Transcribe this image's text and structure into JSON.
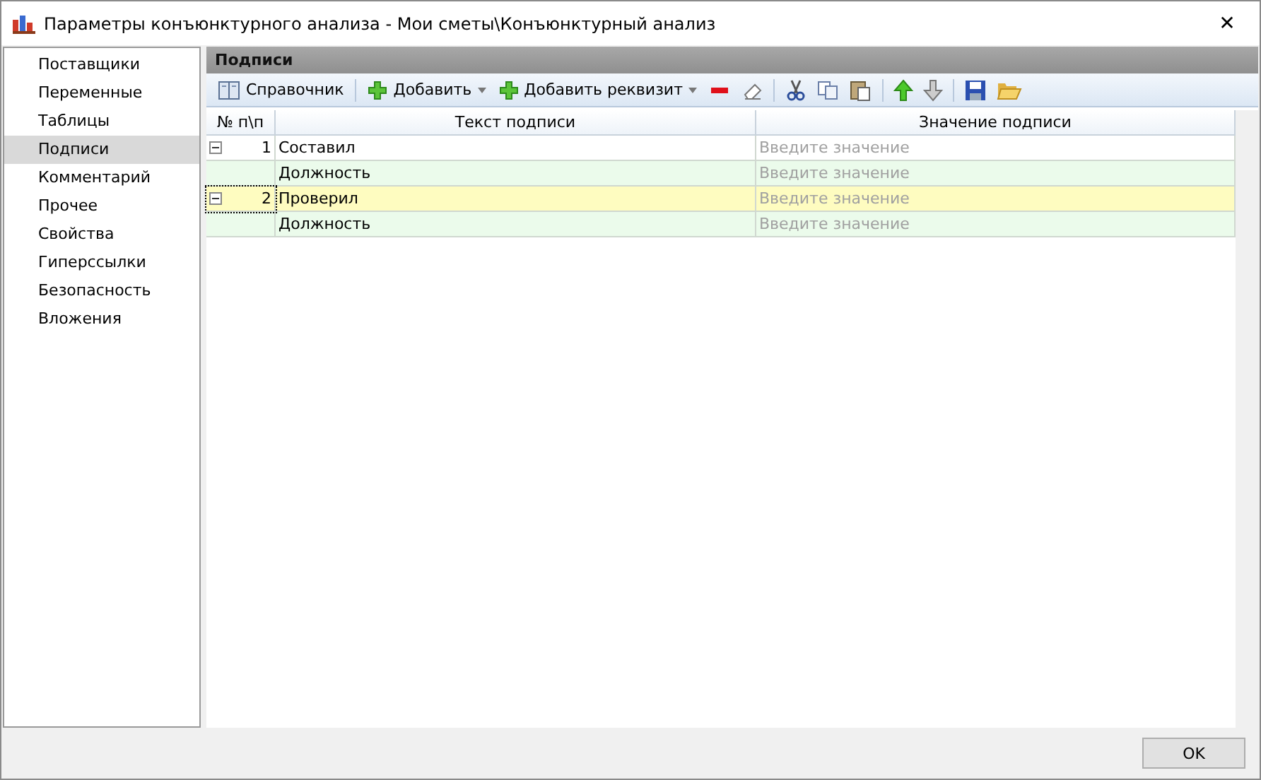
{
  "window": {
    "title": "Параметры конъюнктурного анализа - Мои сметы\\Конъюнктурный анализ",
    "close": "✕"
  },
  "sidebar": {
    "items": [
      {
        "label": "Поставщики",
        "selected": false
      },
      {
        "label": "Переменные",
        "selected": false
      },
      {
        "label": "Таблицы",
        "selected": false
      },
      {
        "label": "Подписи",
        "selected": true
      },
      {
        "label": "Комментарий",
        "selected": false
      },
      {
        "label": "Прочее",
        "selected": false
      },
      {
        "label": "Свойства",
        "selected": false
      },
      {
        "label": "Гиперссылки",
        "selected": false
      },
      {
        "label": "Безопасность",
        "selected": false
      },
      {
        "label": "Вложения",
        "selected": false
      }
    ]
  },
  "panel": {
    "title": "Подписи"
  },
  "toolbar": [
    {
      "label": "Справочник",
      "kind": "button"
    },
    {
      "label": "Добавить",
      "kind": "dropdown"
    },
    {
      "label": "Добавить реквизит",
      "kind": "dropdown"
    }
  ],
  "table": {
    "columns": [
      "№ п\\п",
      "Текст подписи",
      "Значение подписи"
    ],
    "rows": [
      {
        "kind": "parent",
        "number": "1",
        "text": "Составил",
        "placeholder": "Введите значение",
        "selected": false
      },
      {
        "kind": "child",
        "text": "Должность",
        "placeholder": "Введите значение",
        "selected": false
      },
      {
        "kind": "parent",
        "number": "2",
        "text": "Проверил",
        "placeholder": "Введите значение",
        "selected": true
      },
      {
        "kind": "child",
        "text": "Должность",
        "placeholder": "Введите значение",
        "selected": false
      }
    ]
  },
  "buttons": [
    "OK"
  ]
}
